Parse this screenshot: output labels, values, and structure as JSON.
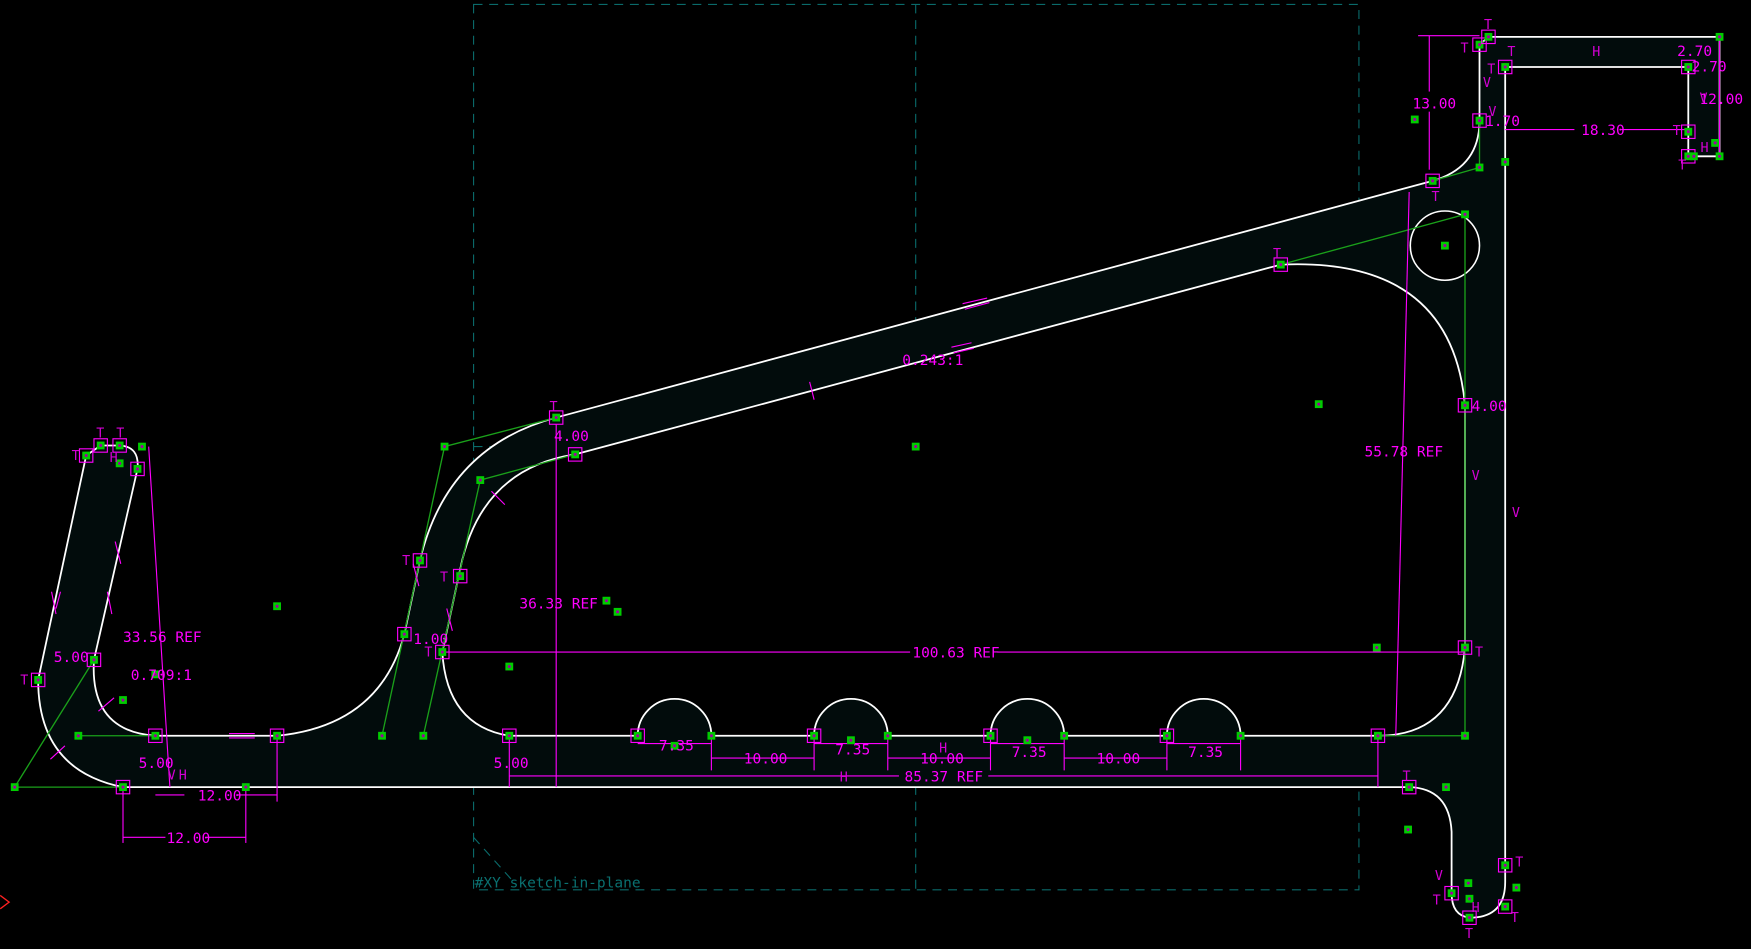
{
  "app": "CAD sketch view",
  "colors": {
    "background": "#000000",
    "edge": "#ffffff",
    "region_fill": "#020c0c",
    "construction": "#1aa01a",
    "point": "#00cc00",
    "dimension": "#ff00ff",
    "workplane": "#0a6a6a",
    "axis_arrow": "#aa0000"
  },
  "workplane_label": "#XY  sketch-in-plane",
  "dims": [
    "13.00",
    "18.30",
    "2.70",
    "2.70",
    "12.00",
    "1.70",
    "55.78  REF",
    "4.00",
    "100.63  REF",
    "36.33  REF",
    "4.00",
    "1.00",
    "0.243:1",
    "33.56  REF",
    "0.709:1",
    "5.00",
    "5.00",
    "12.00",
    "12.00",
    "5.00",
    "7.35",
    "7.35",
    "7.35",
    "7.35",
    "10.00",
    "10.00",
    "10.00",
    "85.37  REF"
  ],
  "constraints": {
    "tangent": "T",
    "horizontal": "H",
    "vertical": "V"
  }
}
